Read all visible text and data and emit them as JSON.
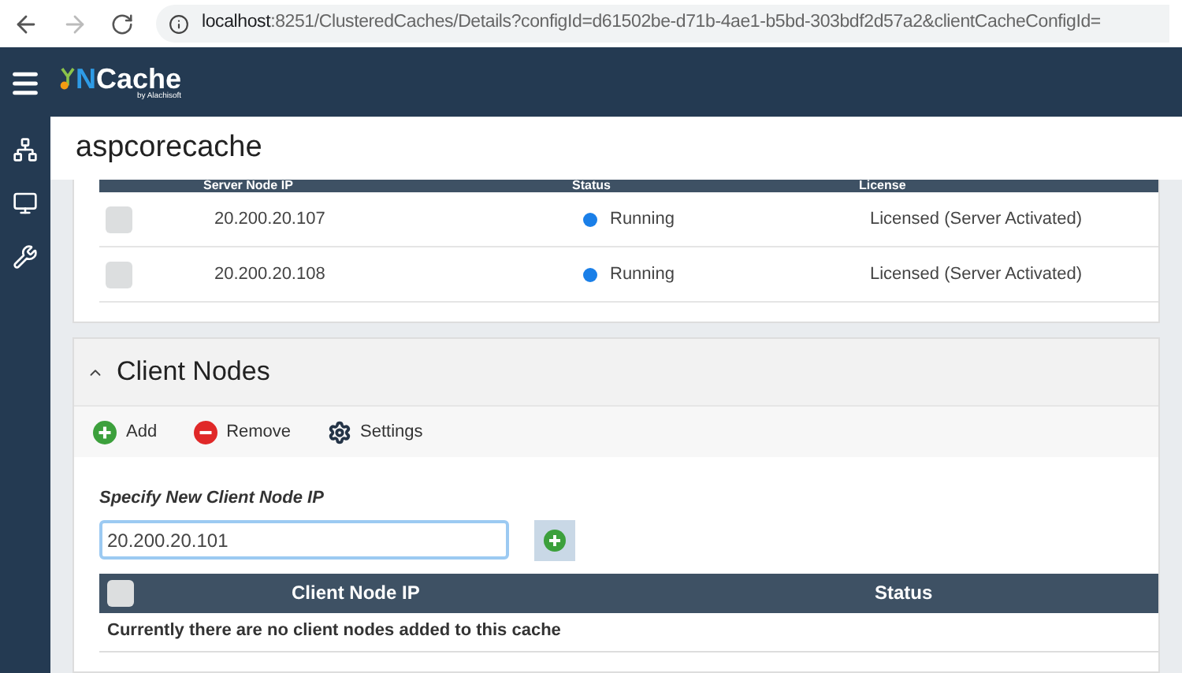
{
  "browser": {
    "url_host": "localhost",
    "url_rest": ":8251/ClusteredCaches/Details?configId=d61502be-d71b-4ae1-b5bd-303bdf2d57a2&clientCacheConfigId="
  },
  "logo": {
    "name": "NCache",
    "byline": "by Alachisoft"
  },
  "page_title": "aspcorecache",
  "server_table": {
    "columns": [
      "Server Node IP",
      "Status",
      "License"
    ],
    "rows": [
      {
        "checked": false,
        "ip": "20.200.20.107",
        "status": "Running",
        "color": "#1a7fe8",
        "license": "Licensed (Server Activated)"
      },
      {
        "checked": false,
        "ip": "20.200.20.108",
        "status": "Running",
        "color": "#1a7fe8",
        "license": "Licensed (Server Activated)"
      }
    ]
  },
  "client_nodes": {
    "title": "Client Nodes",
    "expanded": true,
    "toolbar": [
      {
        "kind": "add",
        "label": "Add"
      },
      {
        "kind": "remove",
        "label": "Remove"
      },
      {
        "kind": "settings",
        "label": "Settings"
      }
    ],
    "field_label": "Specify New Client Node IP",
    "field_value": "20.200.20.101",
    "table": {
      "all_checked": false,
      "columns": [
        "Client Node IP",
        "Status"
      ],
      "empty_message": "Currently there are no client nodes added to this cache"
    }
  }
}
